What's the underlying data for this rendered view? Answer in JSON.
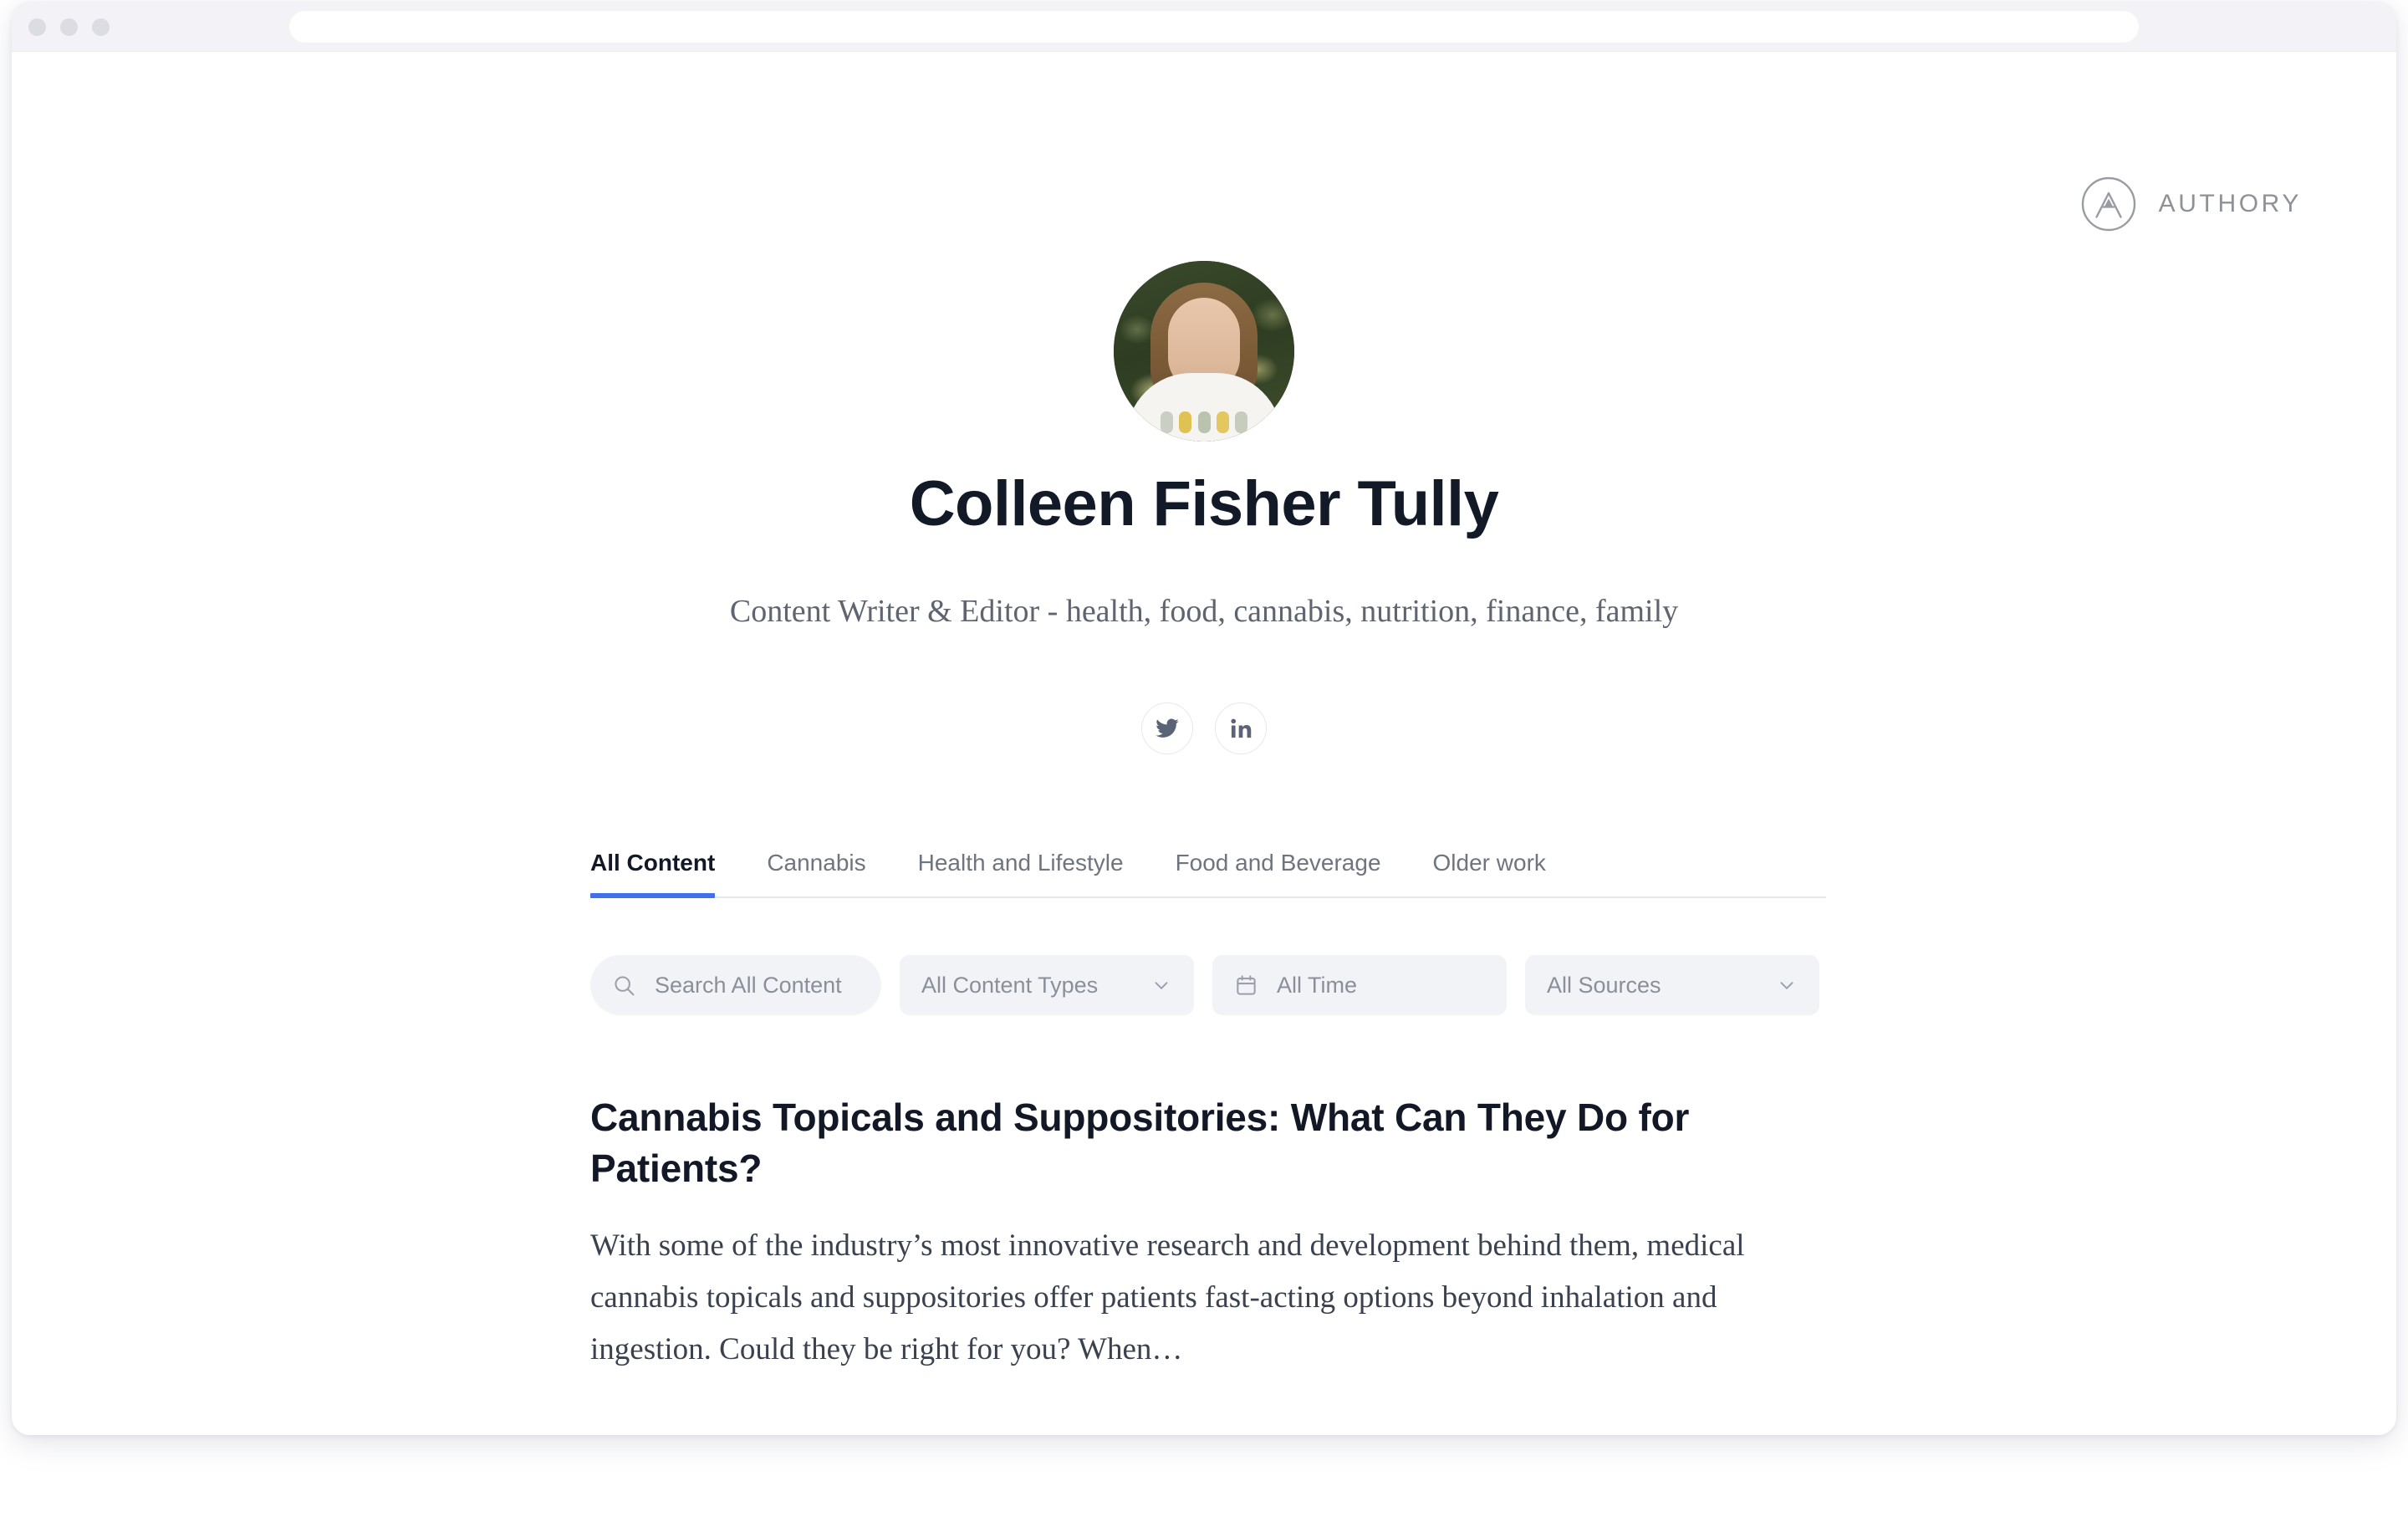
{
  "browser": {
    "traffic_lights": [
      "close",
      "minimize",
      "maximize"
    ],
    "url_value": "",
    "url_placeholder": ""
  },
  "brand": {
    "name": "AUTHORY",
    "logo_icon": "authory-a-circle-icon",
    "color": "#8f9199"
  },
  "profile": {
    "avatar_alt": "Colleen Fisher Tully profile photo",
    "name": "Colleen Fisher Tully",
    "tagline": "Content Writer & Editor - health, food, cannabis, nutrition, finance, family",
    "social": [
      {
        "label": "Twitter",
        "icon": "twitter-icon"
      },
      {
        "label": "LinkedIn",
        "icon": "linkedin-icon"
      }
    ]
  },
  "tabs": [
    {
      "label": "All Content",
      "active": true
    },
    {
      "label": "Cannabis",
      "active": false
    },
    {
      "label": "Health and Lifestyle",
      "active": false
    },
    {
      "label": "Food and Beverage",
      "active": false
    },
    {
      "label": "Older work",
      "active": false
    }
  ],
  "filters": {
    "search": {
      "icon": "search-icon",
      "value": "",
      "placeholder": "Search All Content"
    },
    "content_type": {
      "label": "All Content Types",
      "icon": "chevron-down-icon"
    },
    "time": {
      "label": "All Time",
      "icon": "calendar-icon"
    },
    "sources": {
      "label": "All Sources",
      "icon": "chevron-down-icon"
    }
  },
  "articles": [
    {
      "title": "Cannabis Topicals and Suppositories: What Can They Do for Patients?",
      "excerpt": "With some of the industry’s most innovative research and development behind them, medical cannabis topicals and suppositories offer patients fast-acting options beyond inhalation and ingestion. Could they be right for you? When…"
    }
  ],
  "colors": {
    "accent": "#4071eb",
    "text_dark": "#121826",
    "text_muted": "#6f747f",
    "pill_bg": "#f2f3f7",
    "chrome_bg": "#f2f2f7"
  }
}
